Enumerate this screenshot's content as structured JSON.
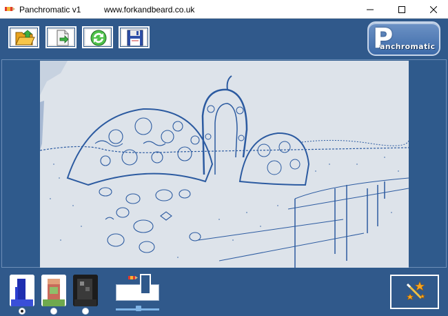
{
  "window": {
    "title": "Panchromatic v1",
    "url": "www.forkandbeard.co.uk"
  },
  "toolbar": {
    "buttons": [
      {
        "name": "open",
        "icon": "folder-open-icon"
      },
      {
        "name": "export",
        "icon": "export-page-icon"
      },
      {
        "name": "refresh",
        "icon": "refresh-icon"
      },
      {
        "name": "save",
        "icon": "floppy-disk-icon"
      }
    ]
  },
  "logo": {
    "letter": "P",
    "word": "anchromatic"
  },
  "image": {
    "description_icon": "sketch-filtered-photo",
    "line_color": "#2b5aa0",
    "paper_color": "#dde3ea"
  },
  "palette": {
    "selected_index": 0,
    "swatches": [
      {
        "name": "blue-tint",
        "icon": "palette-thumbnail-icon"
      },
      {
        "name": "full-color",
        "icon": "palette-thumbnail-icon"
      },
      {
        "name": "dark",
        "icon": "palette-thumbnail-icon"
      }
    ]
  },
  "slider": {
    "level": 0.5
  },
  "colors": {
    "chrome": "#2f5a8c",
    "accent": "#7fb4e6"
  }
}
